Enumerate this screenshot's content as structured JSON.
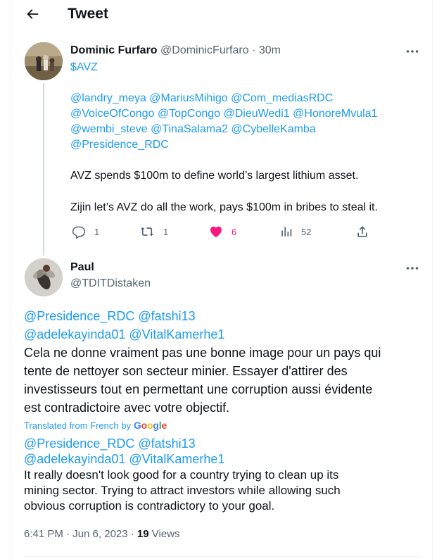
{
  "header": {
    "title": "Tweet",
    "back_icon": "arrow-left-icon"
  },
  "tweet": {
    "author_name": "Dominic Furfaro",
    "author_handle": "@DominicFurfaro",
    "separator": "·",
    "time": "30m",
    "cashtag": "$AVZ",
    "mention_lines": [
      "@landry_meya @MariusMihigo @Com_mediasRDC",
      "@VoiceOfCongo @TopCongo @DieuWedi1 @HonoreMvula1",
      "@wembi_steve @TinaSalama2 @CybelleKamba",
      "@Presidence_RDC"
    ],
    "text_1": "AVZ spends $100m to define world’s largest lithium asset.",
    "text_2": "Zijin let’s AVZ do all the work, pays $100m in bribes to steal it.",
    "actions": {
      "reply_count": "1",
      "retweet_count": "1",
      "like_count": "6",
      "views_count": "52"
    }
  },
  "reply": {
    "author_name": "Paul",
    "author_handle": "@TDITDistaken",
    "mentions_fr_1": "@Presidence_RDC @fatshi13",
    "mentions_fr_2": "@adelekayinda01 @VitalKamerhe1",
    "text_fr": [
      "Cela ne donne vraiment pas une bonne image pour un pays qui",
      "tente de nettoyer son secteur minier. Essayer d'attirer des",
      "investisseurs tout en permettant une corruption aussi évidente",
      "est contradictoire avec votre objectif."
    ],
    "translated_label": "Translated from French by",
    "translator_logo": "Google",
    "mentions_en_1": "@Presidence_RDC @fatshi13",
    "mentions_en_2": "@adelekayinda01 @VitalKamerhe1",
    "text_en": [
      "It really doesn't look good for a country trying to clean up its",
      "mining sector. Trying to attract investors while allowing such",
      "obvious corruption is contradictory to your goal."
    ],
    "timestamp": "6:41 PM · Jun 6, 2023 · ",
    "views_number": "19",
    "views_label": "Views"
  },
  "colors": {
    "link": "#1d9bf0",
    "secondary": "#536471",
    "like": "#f91880",
    "border": "#eff3f4",
    "thread": "#cfd9de"
  }
}
